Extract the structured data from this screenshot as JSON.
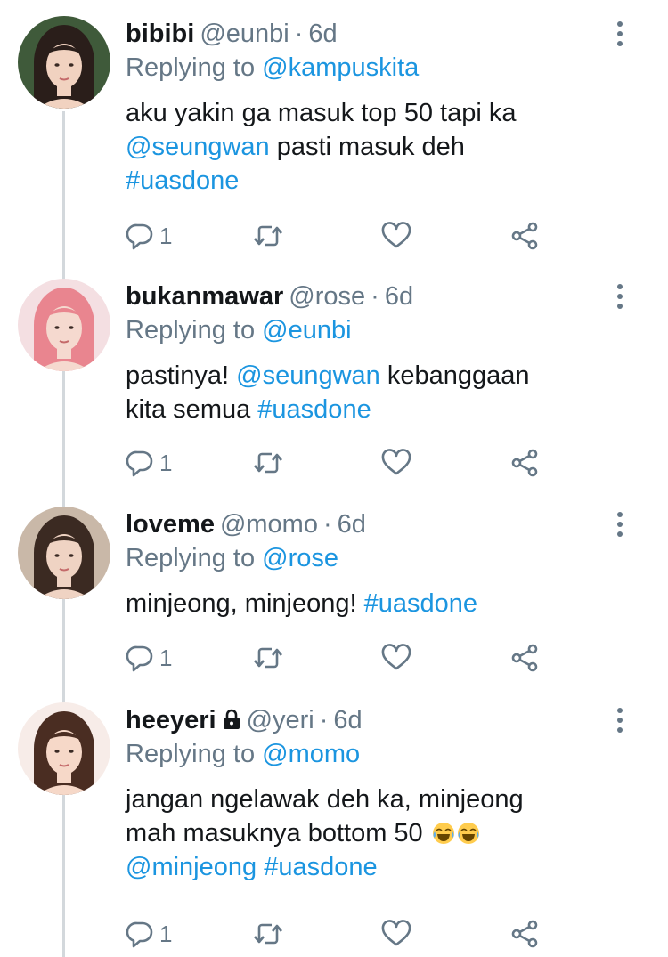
{
  "tweets": [
    {
      "display_name": "bibibi",
      "handle": "@eunbi",
      "separator": "·",
      "time": "6d",
      "replying_prefix": "Replying to",
      "replying_to": "@kampuskita",
      "body": [
        {
          "text": "aku yakin ga masuk top 50 tapi ka",
          "type": "text"
        },
        {
          "text": " ",
          "type": "br"
        },
        {
          "text": "@seungwan",
          "type": "link"
        },
        {
          "text": " pasti masuk deh",
          "type": "text"
        },
        {
          "text": " ",
          "type": "br"
        },
        {
          "text": "#uasdone",
          "type": "link"
        }
      ],
      "reply_count": "1",
      "avatar_colors": {
        "bg": "#3f5a3a",
        "hair": "#2a1e1a",
        "skin": "#f1d2c0"
      }
    },
    {
      "display_name": "bukanmawar",
      "handle": "@rose",
      "separator": "·",
      "time": "6d",
      "replying_prefix": "Replying to",
      "replying_to": "@eunbi",
      "body": [
        {
          "text": "pastinya! ",
          "type": "text"
        },
        {
          "text": "@seungwan",
          "type": "link"
        },
        {
          "text": " kebanggaan",
          "type": "text"
        },
        {
          "text": " ",
          "type": "br"
        },
        {
          "text": "kita semua ",
          "type": "text"
        },
        {
          "text": "#uasdone",
          "type": "link"
        }
      ],
      "reply_count": "1",
      "avatar_colors": {
        "bg": "#f4dfe2",
        "hair": "#e9858f",
        "skin": "#f5d9cf"
      }
    },
    {
      "display_name": "loveme",
      "handle": "@momo",
      "separator": "·",
      "time": "6d",
      "replying_prefix": "Replying to",
      "replying_to": "@rose",
      "body": [
        {
          "text": "minjeong, minjeong! ",
          "type": "text"
        },
        {
          "text": "#uasdone",
          "type": "link"
        }
      ],
      "reply_count": "1",
      "avatar_colors": {
        "bg": "#c9b8a8",
        "hair": "#3b2a22",
        "skin": "#efd3c3"
      }
    },
    {
      "display_name": "heeyeri",
      "handle": "@yeri",
      "separator": "·",
      "time": "6d",
      "replying_prefix": "Replying to",
      "replying_to": "@momo",
      "locked": true,
      "body": [
        {
          "text": "jangan ngelawak deh ka, minjeong",
          "type": "text"
        },
        {
          "text": " ",
          "type": "br"
        },
        {
          "text": "mah masuknya bottom 50 ",
          "type": "text"
        },
        {
          "text": "tears-of-joy-emoji",
          "type": "emoji"
        },
        {
          "text": "tears-of-joy-emoji",
          "type": "emoji"
        },
        {
          "text": " ",
          "type": "br"
        },
        {
          "text": "@minjeong",
          "type": "link"
        },
        {
          "text": " ",
          "type": "text"
        },
        {
          "text": "#uasdone",
          "type": "link"
        }
      ],
      "reply_count": "1",
      "avatar_colors": {
        "bg": "#f7ece8",
        "hair": "#4a2d22",
        "skin": "#f6d8c8"
      }
    }
  ],
  "colors": {
    "text": "#14171a",
    "secondary": "#657786",
    "link": "#1b95e0",
    "thread_line": "#d3d8dc"
  },
  "icons": [
    "reply-icon",
    "retweet-icon",
    "like-icon",
    "share-icon",
    "more-options-icon",
    "lock-icon"
  ]
}
